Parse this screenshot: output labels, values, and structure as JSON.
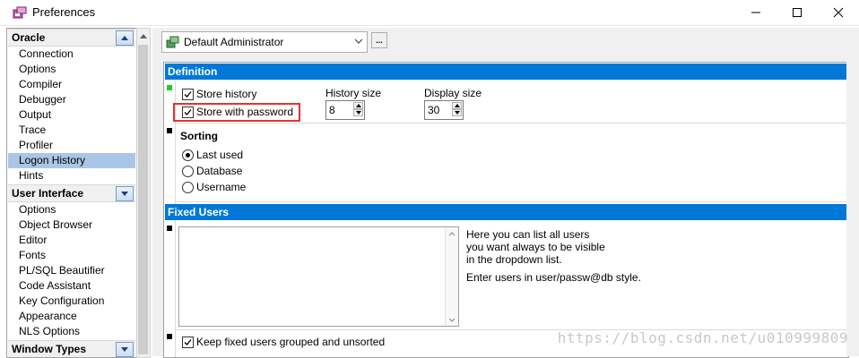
{
  "window": {
    "title": "Preferences"
  },
  "sidebar": {
    "groups": [
      {
        "label": "Oracle",
        "items": [
          "Connection",
          "Options",
          "Compiler",
          "Debugger",
          "Output",
          "Trace",
          "Profiler",
          "Logon History",
          "Hints"
        ],
        "selected": "Logon History"
      },
      {
        "label": "User Interface",
        "items": [
          "Options",
          "Object Browser",
          "Editor",
          "Fonts",
          "PL/SQL Beautifier",
          "Code Assistant",
          "Key Configuration",
          "Appearance",
          "NLS Options"
        ]
      },
      {
        "label": "Window Types",
        "items": []
      }
    ]
  },
  "user_select": {
    "value": "Default Administrator",
    "ellipsis": "..."
  },
  "definition": {
    "header": "Definition",
    "store_history": {
      "label": "Store history",
      "checked": true
    },
    "store_with_password": {
      "label": "Store with password",
      "checked": true
    },
    "history_size": {
      "label": "History size",
      "value": "8"
    },
    "display_size": {
      "label": "Display size",
      "value": "30"
    },
    "sorting": {
      "label": "Sorting",
      "options": [
        "Last used",
        "Database",
        "Username"
      ],
      "selected": "Last used"
    }
  },
  "fixed_users": {
    "header": "Fixed Users",
    "help_line1": "Here you can list all users",
    "help_line2": "you want always to be visible",
    "help_line3": "in the dropdown list.",
    "help_line4": "Enter users in user/passw@db style.",
    "keep_grouped": {
      "label": "Keep fixed users grouped and unsorted",
      "checked": true
    }
  },
  "watermark": "https://blog.csdn.net/u010999809",
  "colors": {
    "section_header": "#0078d7",
    "selected_item": "#aac6e6",
    "highlight": "#e5322d",
    "marker_green": "#22cc22"
  }
}
